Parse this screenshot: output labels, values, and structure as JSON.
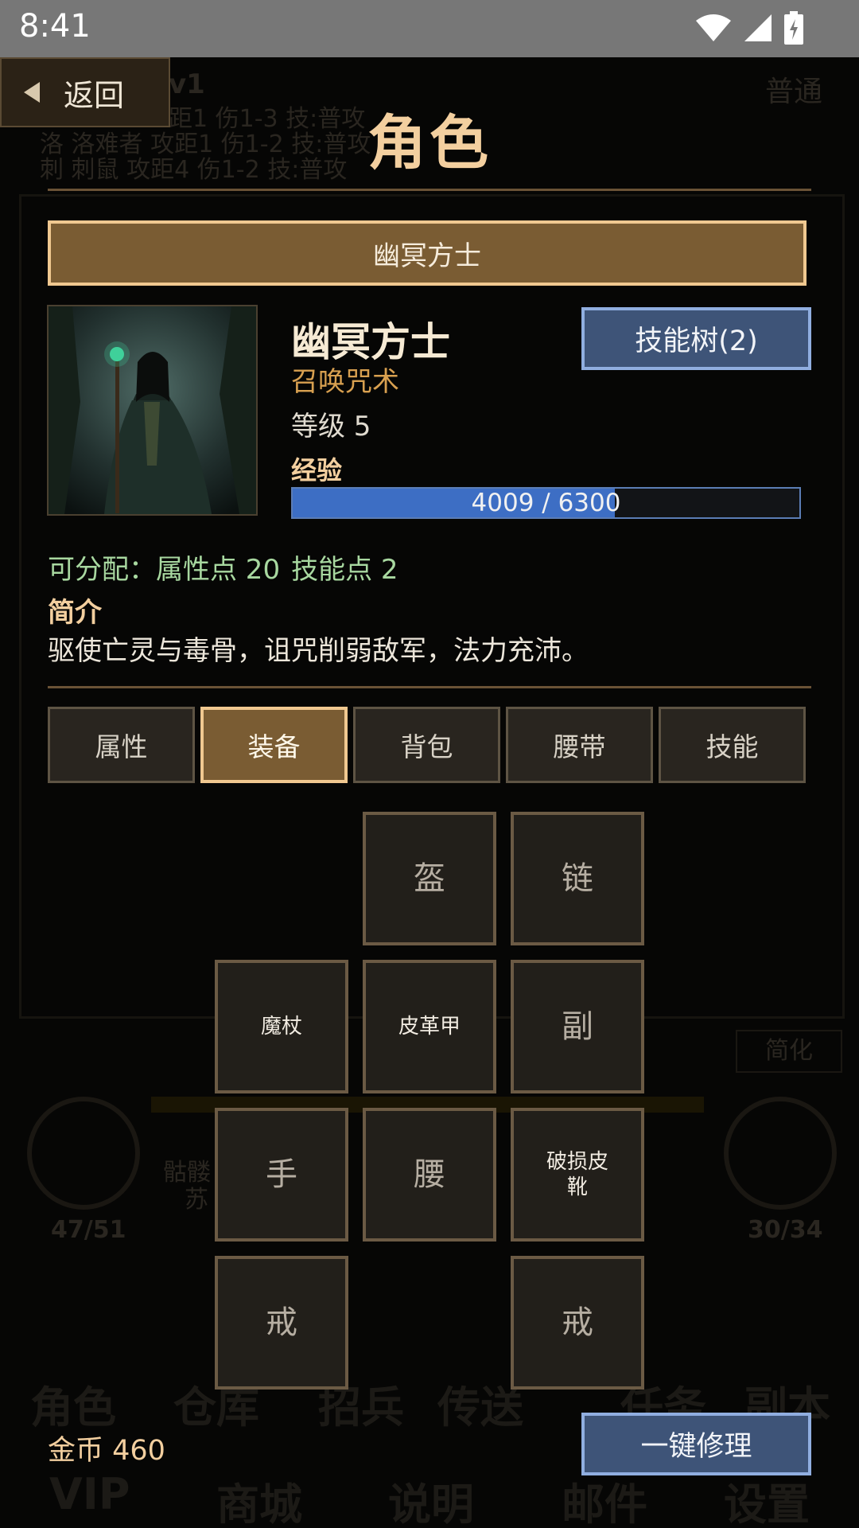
{
  "status_bar": {
    "time": "8:41"
  },
  "background": {
    "header_level": "v1",
    "lines": [
      "距1 伤1-3 技:普攻",
      "洛 洛难者 攻距1 伤1-2 技:普攻",
      "刺 刺鼠 攻距4 伤1-2 技:普攻"
    ],
    "mode": "普通",
    "simplify": "简化",
    "hp": "47/51",
    "mp": "30/34",
    "party_name": "骷髅",
    "party_sub": "苏",
    "nav_row1": [
      "角色",
      "仓库",
      "招兵",
      "传送",
      "任务",
      "副本"
    ],
    "nav_row2": [
      "VIP",
      "商城",
      "说明",
      "邮件",
      "设置"
    ]
  },
  "back_button": {
    "label": "返回"
  },
  "page": {
    "title": "角色"
  },
  "class_banner": {
    "label": "幽冥方士"
  },
  "character": {
    "name": "幽冥方士",
    "subclass": "召唤咒术",
    "level": "等级 5",
    "exp_label": "经验",
    "exp_text": "4009 / 6300",
    "exp_fraction": 0.636,
    "alloc_prefix": "可分配：",
    "attr_points": "属性点 20",
    "skill_points": "技能点 2",
    "intro_label": "简介",
    "intro": "驱使亡灵与毒骨，诅咒削弱敌军，法力充沛。"
  },
  "skill_tree_button": {
    "label": "技能树(2)"
  },
  "tabs": [
    {
      "label": "属性",
      "active": false
    },
    {
      "label": "装备",
      "active": true
    },
    {
      "label": "背包",
      "active": false
    },
    {
      "label": "腰带",
      "active": false
    },
    {
      "label": "技能",
      "active": false
    }
  ],
  "equipment": {
    "helmet": "盔",
    "amulet": "链",
    "weapon": "魔杖",
    "armor": "皮革甲",
    "offhand": "副",
    "gloves": "手",
    "belt": "腰",
    "boots": "破损皮\n靴",
    "ring_left": "戒",
    "ring_right": "戒"
  },
  "footer": {
    "gold": "金币 460",
    "repair_label": "一键修理"
  },
  "colors": {
    "accent_gold": "#f3cf9f",
    "button_blue": "#3e5478",
    "exp_blue": "#3d6ec4",
    "alloc_green": "#a8d8a0"
  }
}
